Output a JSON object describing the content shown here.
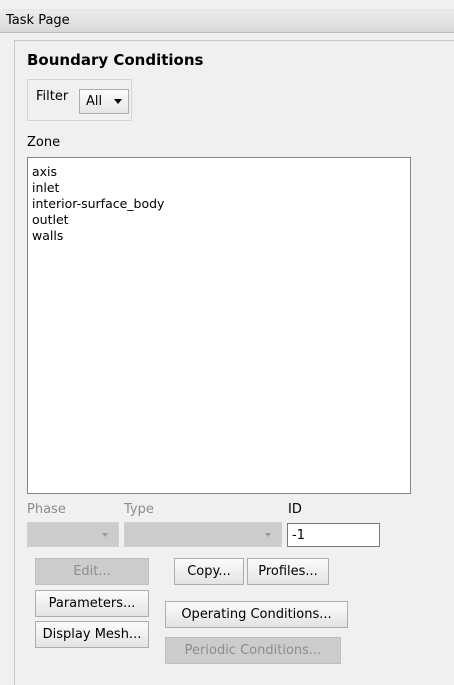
{
  "window": {
    "title": "Task Page"
  },
  "panel": {
    "heading": "Boundary Conditions"
  },
  "filter": {
    "label": "Filter",
    "selected": "All"
  },
  "zone": {
    "label": "Zone",
    "items": [
      "axis",
      "inlet",
      "interior-surface_body",
      "outlet",
      "walls"
    ]
  },
  "fields": {
    "phase_label": "Phase",
    "type_label": "Type",
    "id_label": "ID",
    "id_value": "-1"
  },
  "buttons": {
    "edit": "Edit...",
    "copy": "Copy...",
    "profiles": "Profiles...",
    "parameters": "Parameters...",
    "operating_conditions": "Operating Conditions...",
    "display_mesh": "Display Mesh...",
    "periodic_conditions": "Periodic Conditions..."
  }
}
